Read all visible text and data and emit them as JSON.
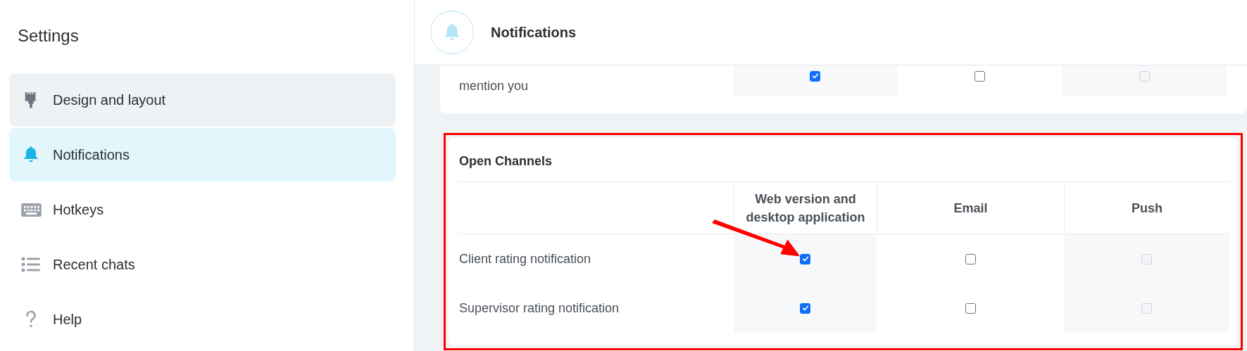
{
  "sidebar": {
    "title": "Settings",
    "items": [
      {
        "label": "Design and layout",
        "selected": false,
        "hovered": true
      },
      {
        "label": "Notifications",
        "selected": true,
        "hovered": false
      },
      {
        "label": "Hotkeys",
        "selected": false,
        "hovered": false
      },
      {
        "label": "Recent chats",
        "selected": false,
        "hovered": false
      },
      {
        "label": "Help",
        "selected": false,
        "hovered": false
      }
    ]
  },
  "header": {
    "title": "Notifications"
  },
  "previous_section": {
    "rows": [
      {
        "label": "mention you",
        "channels": [
          {
            "checked": true,
            "disabled": false
          },
          {
            "checked": false,
            "disabled": false
          },
          {
            "checked": false,
            "disabled": true
          }
        ]
      }
    ]
  },
  "open_channels": {
    "title": "Open Channels",
    "columns": [
      "Web version and desktop application",
      "Email",
      "Push"
    ],
    "rows": [
      {
        "label": "Client rating notification",
        "channels": [
          {
            "checked": true,
            "disabled": false
          },
          {
            "checked": false,
            "disabled": false
          },
          {
            "checked": false,
            "disabled": true
          }
        ]
      },
      {
        "label": "Supervisor rating notification",
        "channels": [
          {
            "checked": true,
            "disabled": false
          },
          {
            "checked": false,
            "disabled": false
          },
          {
            "checked": false,
            "disabled": true
          }
        ]
      }
    ]
  },
  "annotations": {
    "highlight_frame": true,
    "arrow": true
  }
}
